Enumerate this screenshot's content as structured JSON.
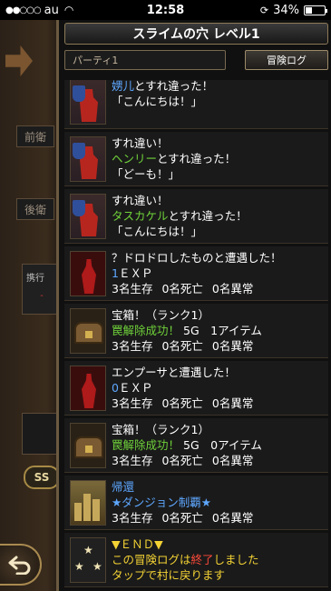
{
  "status_bar": {
    "signal": "●●○○○",
    "carrier": "au",
    "time": "12:58",
    "battery_percent": "34%",
    "battery_level": 0.34
  },
  "background": {
    "label_front": "前衛",
    "label_back": "後衛",
    "card_label": "携行",
    "card_value": "-",
    "ss_badge": "SS"
  },
  "header": {
    "title": "スライムの穴 レベル1",
    "party_field": "パーティ1",
    "log_button": "冒険ログ"
  },
  "log_entries": [
    {
      "thumb": "hero",
      "lines": [
        [
          {
            "text": "娚儿",
            "color": "blue"
          },
          {
            "text": "とすれ違った！",
            "color": "white"
          }
        ],
        [
          {
            "text": "「こんにちは！」",
            "color": "white"
          }
        ]
      ]
    },
    {
      "thumb": "hero",
      "lines": [
        [
          {
            "text": "すれ違い！",
            "color": "white"
          }
        ],
        [
          {
            "text": "ヘンリー",
            "color": "green"
          },
          {
            "text": "とすれ違った！",
            "color": "white"
          }
        ],
        [
          {
            "text": "「どーも！」",
            "color": "white"
          }
        ]
      ]
    },
    {
      "thumb": "hero",
      "lines": [
        [
          {
            "text": "すれ違い！",
            "color": "white"
          }
        ],
        [
          {
            "text": "タスカケル",
            "color": "green"
          },
          {
            "text": "とすれ違った！",
            "color": "white"
          }
        ],
        [
          {
            "text": "「こんにちは！」",
            "color": "white"
          }
        ]
      ]
    },
    {
      "thumb": "ghost",
      "lines": [
        [
          {
            "text": "？ドロドロしたものと遭遇した！",
            "color": "white"
          }
        ],
        [
          {
            "text": "1",
            "color": "blue"
          },
          {
            "text": "ＥＸＰ",
            "color": "white"
          }
        ],
        [
          {
            "text": "3名生存",
            "color": "white"
          },
          {
            "text": "0名死亡",
            "color": "white"
          },
          {
            "text": "0名異常",
            "color": "white"
          }
        ]
      ]
    },
    {
      "thumb": "chest",
      "lines": [
        [
          {
            "text": "宝箱！（ランク1）",
            "color": "white"
          }
        ],
        [
          {
            "text": "罠解除成功！",
            "color": "green"
          },
          {
            "text": " 5G　1アイテム",
            "color": "white"
          }
        ],
        [
          {
            "text": "3名生存",
            "color": "white"
          },
          {
            "text": "0名死亡",
            "color": "white"
          },
          {
            "text": "0名異常",
            "color": "white"
          }
        ]
      ]
    },
    {
      "thumb": "ghost",
      "lines": [
        [
          {
            "text": "エンプーサと遭遇した！",
            "color": "white"
          }
        ],
        [
          {
            "text": "0",
            "color": "blue"
          },
          {
            "text": "ＥＸＰ",
            "color": "white"
          }
        ],
        [
          {
            "text": "3名生存",
            "color": "white"
          },
          {
            "text": "0名死亡",
            "color": "white"
          },
          {
            "text": "0名異常",
            "color": "white"
          }
        ]
      ]
    },
    {
      "thumb": "chest",
      "lines": [
        [
          {
            "text": "宝箱！（ランク1）",
            "color": "white"
          }
        ],
        [
          {
            "text": "罠解除成功！",
            "color": "green"
          },
          {
            "text": " 5G　0アイテム",
            "color": "white"
          }
        ],
        [
          {
            "text": "3名生存",
            "color": "white"
          },
          {
            "text": "0名死亡",
            "color": "white"
          },
          {
            "text": "0名異常",
            "color": "white"
          }
        ]
      ]
    },
    {
      "thumb": "city",
      "lines": [
        [
          {
            "text": "帰還",
            "color": "blue"
          }
        ],
        [
          {
            "text": "★ダンジョン制覇★",
            "color": "blue"
          }
        ],
        [
          {
            "text": "3名生存",
            "color": "white"
          },
          {
            "text": "0名死亡",
            "color": "white"
          },
          {
            "text": "0名異常",
            "color": "white"
          }
        ]
      ]
    },
    {
      "thumb": "stars",
      "lines": [
        [
          {
            "text": "▼ＥＮＤ▼",
            "color": "yellow"
          }
        ],
        [
          {
            "text": "この冒険ログは",
            "color": "yellow"
          },
          {
            "text": "終了",
            "color": "red"
          },
          {
            "text": "しました",
            "color": "yellow"
          }
        ],
        [
          {
            "text": "タップで村に戻ります",
            "color": "yellow"
          }
        ]
      ]
    }
  ],
  "colors": {
    "white": "#ffffff",
    "green": "#6fd13a",
    "blue": "#5ea7ff",
    "yellow": "#f3d234",
    "red": "#ff4a3a"
  }
}
